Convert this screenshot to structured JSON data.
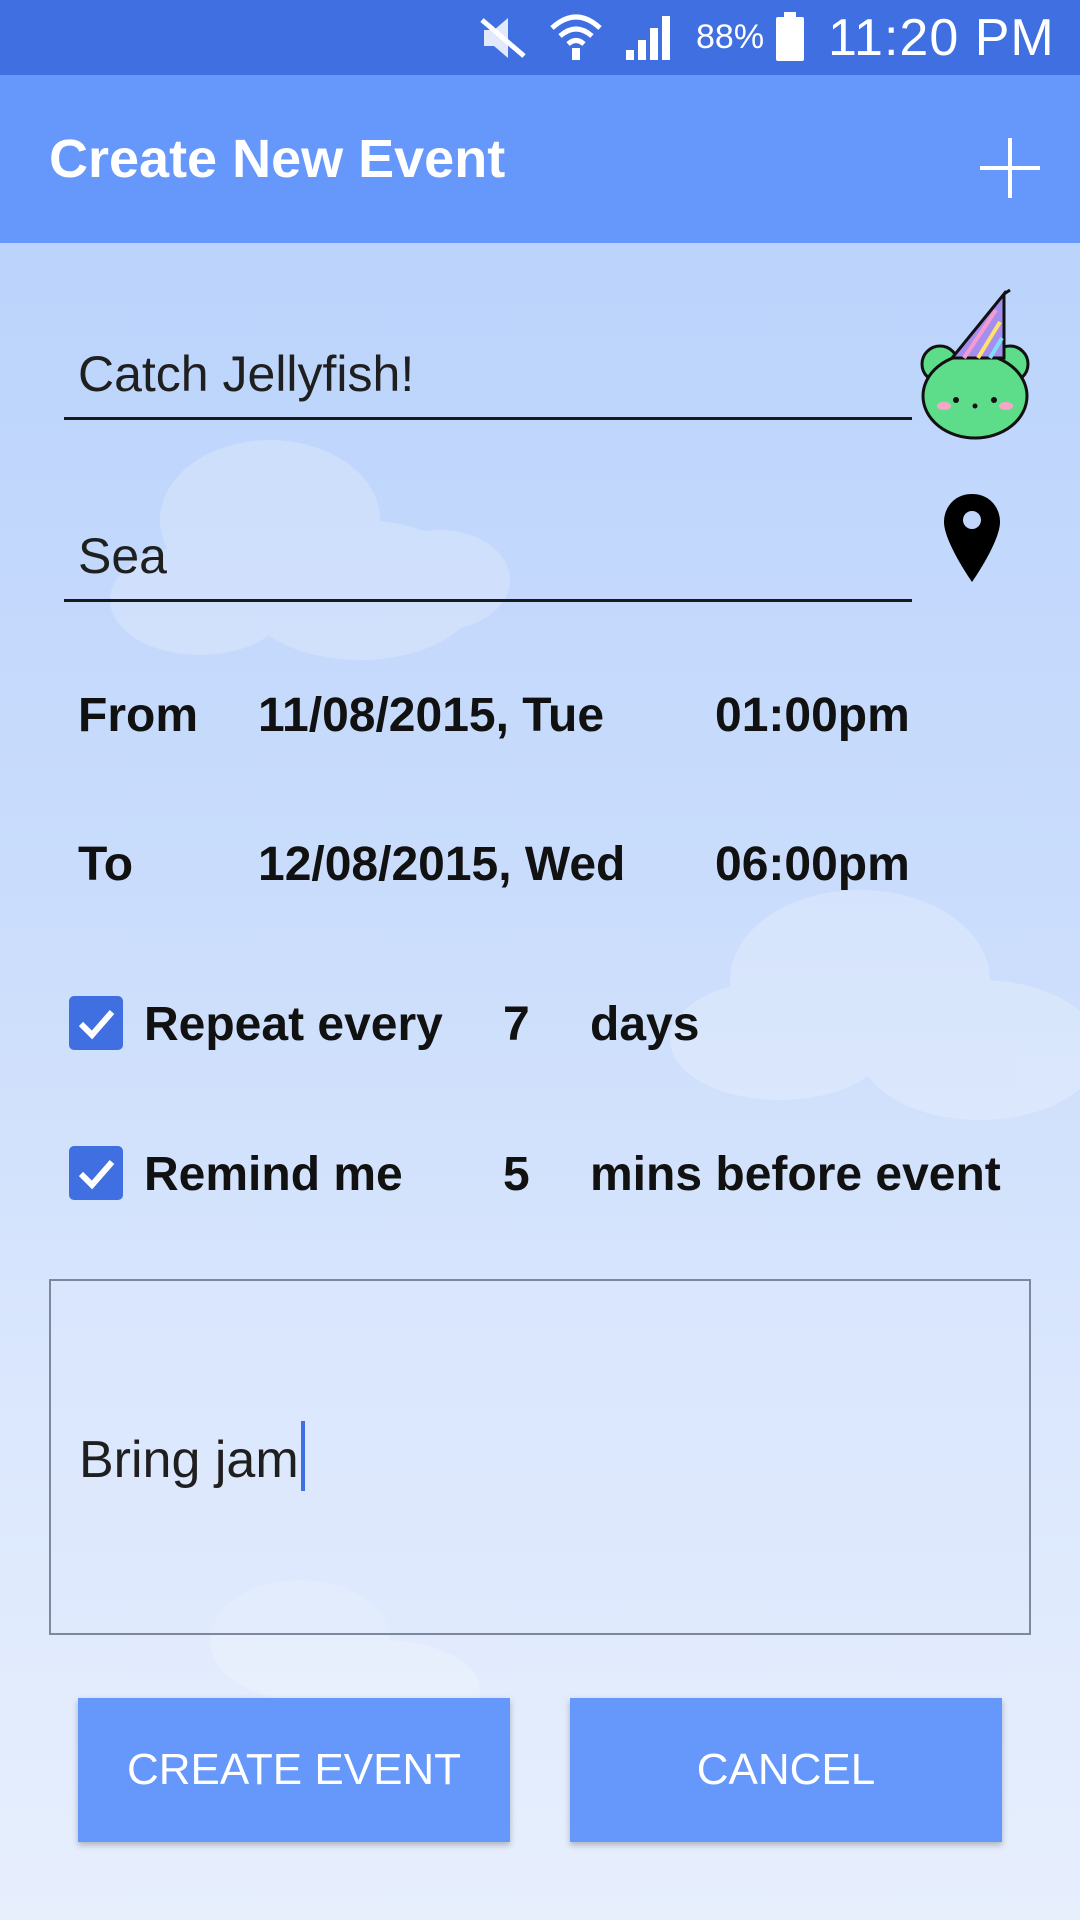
{
  "status_bar": {
    "battery_percent": "88%",
    "time": "11:20 PM",
    "icons": [
      "mute-icon",
      "wifi-icon",
      "signal-icon",
      "battery-icon"
    ]
  },
  "app_bar": {
    "title": "Create New Event",
    "action_icon": "plus-icon"
  },
  "form": {
    "event_name": "Catch Jellyfish!",
    "location": "Sea",
    "event_icon": "frog-party-hat-icon",
    "location_icon": "map-pin-icon",
    "from": {
      "label": "From",
      "date": "11/08/2015, Tue",
      "time": "01:00pm"
    },
    "to": {
      "label": "To",
      "date": "12/08/2015, Wed",
      "time": "06:00pm"
    },
    "repeat": {
      "checked": true,
      "label": "Repeat every",
      "value": "7",
      "unit": "days"
    },
    "remind": {
      "checked": true,
      "label": "Remind me",
      "value": "5",
      "unit": "mins before event"
    },
    "notes": "Bring jam"
  },
  "buttons": {
    "create": "CREATE EVENT",
    "cancel": "CANCEL"
  },
  "colors": {
    "status_bar": "#3f6fe0",
    "app_bar": "#6697fb",
    "accent": "#3f6fe0",
    "button": "#6697fb"
  }
}
